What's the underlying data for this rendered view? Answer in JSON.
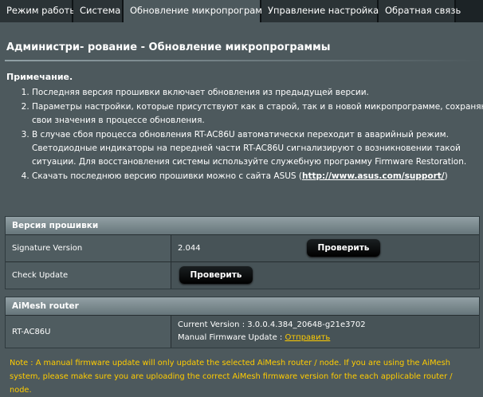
{
  "tabs": [
    {
      "label": "Режим работы",
      "active": false
    },
    {
      "label": "Система",
      "active": false
    },
    {
      "label": "Обновление микропрограммы",
      "active": true
    },
    {
      "label": "Управление настройками",
      "active": false
    },
    {
      "label": "Обратная связь",
      "active": false
    }
  ],
  "page": {
    "heading": "Администри- рование - Обновление микропрограммы",
    "note_title": "Примечание.",
    "notes": {
      "n1": "Последняя версия прошивки включает обновления из предыдущей версии.",
      "n2": "Параметры настройки, которые присутствуют как в старой, так и в новой микропрограмме, сохраняют свои значения в процессе обновления.",
      "n3": "В случае сбоя процесса обновления RT-AC86U автоматически переходит в аварийный режим. Светодиодные индикаторы на передней части RT-AC86U сигнализируют о возникновении такой ситуации. Для восстановления системы используйте служебную программу Firmware Restoration.",
      "n4_prefix": "Скачать последнюю версию прошивки можно с сайта ASUS (",
      "n4_link": "http://www.asus.com/support/",
      "n4_suffix": ")"
    }
  },
  "firmware_section": {
    "title": "Версия прошивки",
    "signature_label": "Signature Version",
    "signature_value": "2.044",
    "check_button": "Проверить",
    "check_update_label": "Check Update",
    "check_update_button": "Проверить"
  },
  "aimesh_section": {
    "title": "AiMesh router",
    "router_name": "RT-AC86U",
    "current_version": "Current Version : 3.0.0.4.384_20648-g21e3702",
    "manual_update_label": "Manual Firmware Update : ",
    "manual_update_link": "Отправить"
  },
  "footer_note": "Note : A manual firmware update will only update the selected AiMesh router / node. If you are using the AiMesh system, please make sure you are uploading the correct AiMesh firmware version for the each applicable router / node."
}
